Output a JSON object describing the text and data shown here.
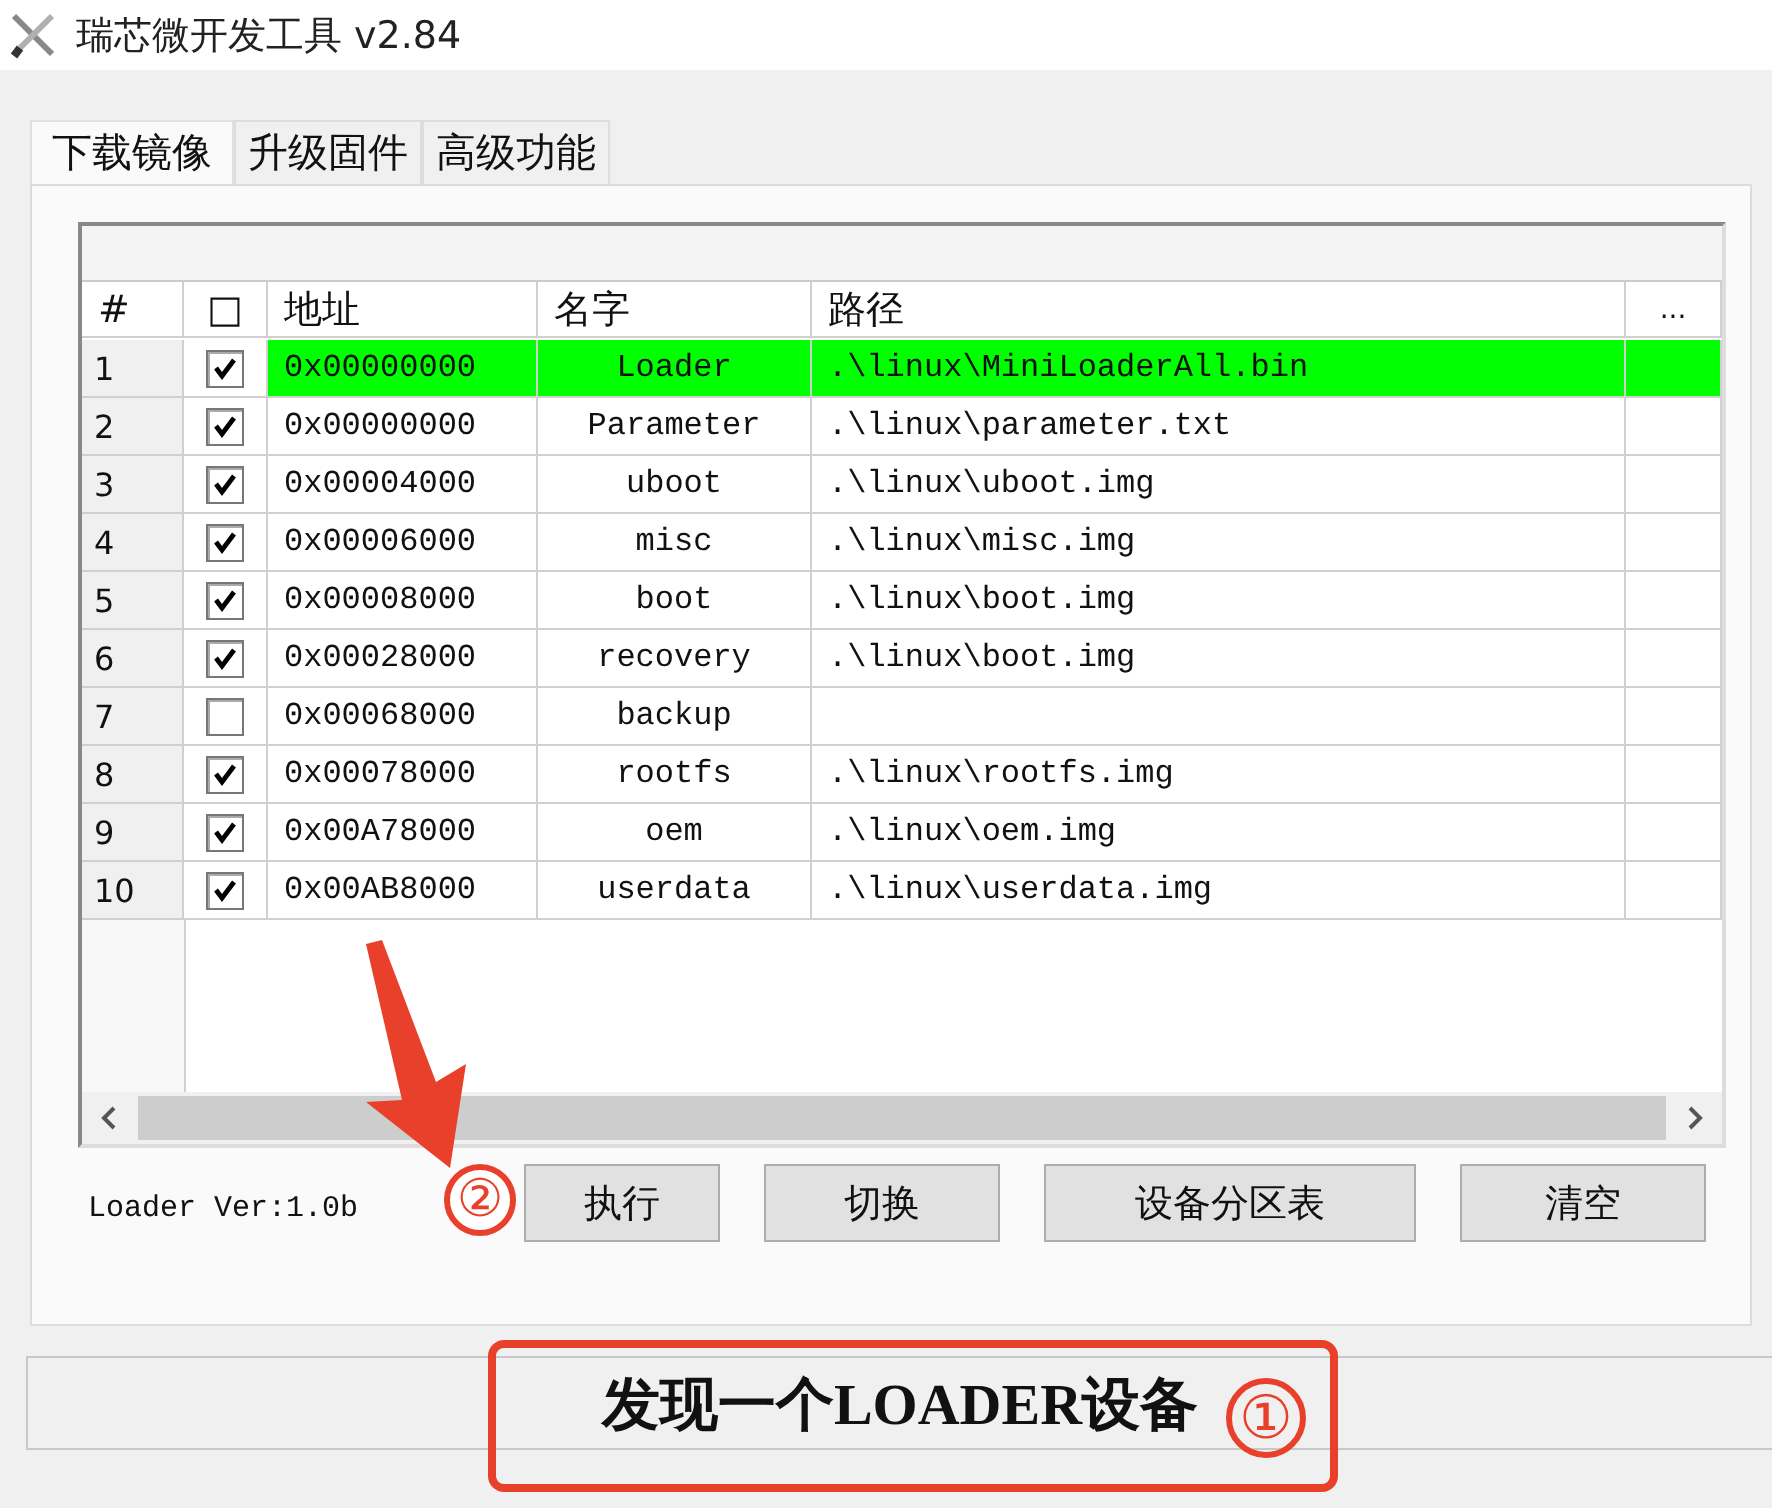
{
  "window": {
    "title": "瑞芯微开发工具 v2.84"
  },
  "tabs": [
    {
      "label": "下载镜像",
      "selected": true
    },
    {
      "label": "升级固件",
      "selected": false
    },
    {
      "label": "高级功能",
      "selected": false
    }
  ],
  "table": {
    "columns": [
      "#",
      "□",
      "地址",
      "名字",
      "路径",
      "..."
    ],
    "rows": [
      {
        "index": "1",
        "checked": true,
        "selected": true,
        "address": "0x00000000",
        "name": "Loader",
        "path": ".\\linux\\MiniLoaderAll.bin"
      },
      {
        "index": "2",
        "checked": true,
        "selected": false,
        "address": "0x00000000",
        "name": "Parameter",
        "path": ".\\linux\\parameter.txt"
      },
      {
        "index": "3",
        "checked": true,
        "selected": false,
        "address": "0x00004000",
        "name": "uboot",
        "path": ".\\linux\\uboot.img"
      },
      {
        "index": "4",
        "checked": true,
        "selected": false,
        "address": "0x00006000",
        "name": "misc",
        "path": ".\\linux\\misc.img"
      },
      {
        "index": "5",
        "checked": true,
        "selected": false,
        "address": "0x00008000",
        "name": "boot",
        "path": ".\\linux\\boot.img"
      },
      {
        "index": "6",
        "checked": true,
        "selected": false,
        "address": "0x00028000",
        "name": "recovery",
        "path": ".\\linux\\boot.img"
      },
      {
        "index": "7",
        "checked": false,
        "selected": false,
        "address": "0x00068000",
        "name": "backup"
      },
      {
        "index": "8",
        "checked": true,
        "selected": false,
        "address": "0x00078000",
        "name": "rootfs",
        "path": ".\\linux\\rootfs.img"
      },
      {
        "index": "9",
        "checked": true,
        "selected": false,
        "address": "0x00A78000",
        "name": "oem",
        "path": ".\\linux\\oem.img"
      },
      {
        "index": "10",
        "checked": true,
        "selected": false,
        "address": "0x00AB8000",
        "name": "userdata",
        "path": ".\\linux\\userdata.img"
      }
    ]
  },
  "loader_version": "Loader Ver:1.0b",
  "buttons": [
    {
      "label": "执行",
      "marker": "②",
      "pointer_arrow": true
    },
    {
      "label": "切换"
    },
    {
      "label": "设备分区表"
    },
    {
      "label": "清空"
    }
  ],
  "status_bar": {
    "text": "发现一个LOADER设备",
    "marker": "①",
    "framed": true
  }
}
